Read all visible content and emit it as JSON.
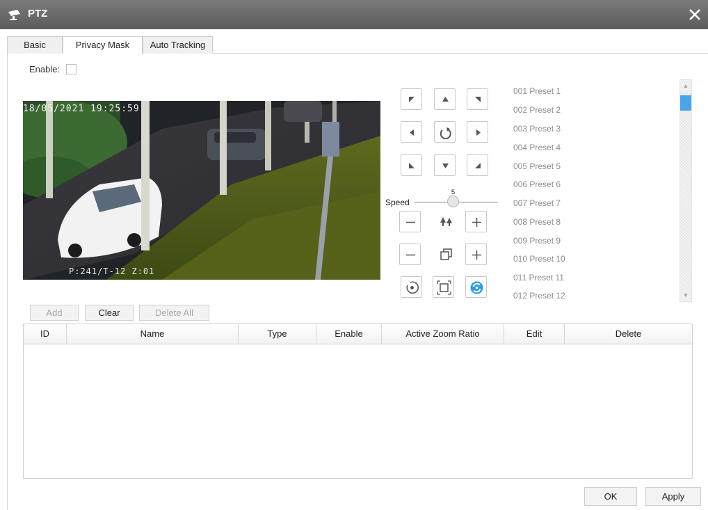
{
  "window": {
    "title": "PTZ",
    "icon": "camera-icon",
    "close_icon": "close-icon"
  },
  "tabs": [
    {
      "label": "Basic",
      "active": false
    },
    {
      "label": "Privacy Mask",
      "active": true
    },
    {
      "label": "Auto Tracking",
      "active": false
    }
  ],
  "enable": {
    "label": "Enable:",
    "checked": false
  },
  "video": {
    "osd_time": "18/05/2021 19:25:59",
    "osd_position": "P:241/T-12  Z:01"
  },
  "ptz": {
    "speed_label": "Speed",
    "speed_value": "5",
    "directions": [
      "up-left",
      "up",
      "up-right",
      "left",
      "reset",
      "right",
      "down-left",
      "down",
      "down-right"
    ],
    "focus_icon": "focus-icon",
    "iris_icon": "iris-icon",
    "extra_icons": [
      "home-icon",
      "zoom-area-icon",
      "tracking-icon"
    ]
  },
  "presets": [
    "001  Preset 1",
    "002  Preset 2",
    "003  Preset 3",
    "004  Preset 4",
    "005  Preset 5",
    "006  Preset 6",
    "007  Preset 7",
    "008  Preset 8",
    "009  Preset 9",
    "010  Preset 10",
    "011  Preset 11",
    "012  Preset 12"
  ],
  "actions": {
    "add": "Add",
    "clear": "Clear",
    "delete_all": "Delete All"
  },
  "table": {
    "columns": [
      "ID",
      "Name",
      "Type",
      "Enable",
      "Active Zoom Ratio",
      "Edit",
      "Delete"
    ],
    "rows": []
  },
  "footer": {
    "ok": "OK",
    "apply": "Apply"
  },
  "colors": {
    "accent": "#2d9be6",
    "titlebar": "#666666"
  }
}
